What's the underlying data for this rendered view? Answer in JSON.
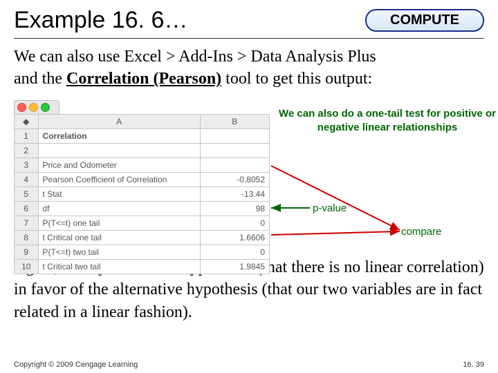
{
  "header": {
    "title": "Example 16. 6…",
    "badge": "COMPUTE"
  },
  "intro": {
    "line1": "We can also use Excel > Add-Ins > Data Analysis Plus",
    "line2_prefix": "and the ",
    "tool": "Correlation (Pearson)",
    "line2_suffix": " tool to get this output:"
  },
  "excel": {
    "colA": "A",
    "colB": "B",
    "rows": [
      {
        "n": "1",
        "a": "Correlation",
        "b": "",
        "bold": true
      },
      {
        "n": "2",
        "a": "",
        "b": ""
      },
      {
        "n": "3",
        "a": "Price and Odometer",
        "b": ""
      },
      {
        "n": "4",
        "a": "Pearson Coefficient of Correlation",
        "b": "-0.8052"
      },
      {
        "n": "5",
        "a": "t Stat",
        "b": "-13.44"
      },
      {
        "n": "6",
        "a": "df",
        "b": "98"
      },
      {
        "n": "7",
        "a": "P(T<=t) one tail",
        "b": "0"
      },
      {
        "n": "8",
        "a": "t Critical one tail",
        "b": "1.6606"
      },
      {
        "n": "9",
        "a": "P(T<=t) two tail",
        "b": "0"
      },
      {
        "n": "10",
        "a": "t Critical two tail",
        "b": "1.9845"
      }
    ]
  },
  "annotations": {
    "onetail": "We can also do a one-tail test for positive or negative linear relationships",
    "pvalue": "p-value",
    "compare": "compare"
  },
  "conclusion": "Again, we reject the null hypothesis (that there is no linear correlation) in favor of the alternative hypothesis (that our two variables are in fact related in a linear fashion).",
  "footer": {
    "copyright": "Copyright © 2009 Cengage Learning",
    "pageno": "16. 39"
  },
  "chart_data": {
    "type": "table",
    "title": "Correlation",
    "subject": "Price and Odometer",
    "stats": {
      "pearson_r": -0.8052,
      "t_stat": -13.44,
      "df": 98,
      "p_one_tail": 0,
      "t_crit_one_tail": 1.6606,
      "p_two_tail": 0,
      "t_crit_two_tail": 1.9845
    }
  }
}
